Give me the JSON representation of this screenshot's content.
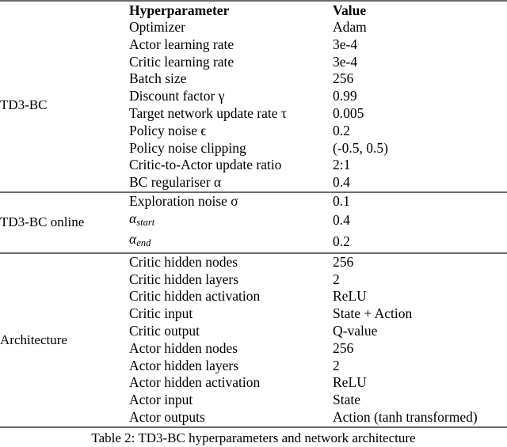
{
  "table": {
    "columns": {
      "group": "",
      "hyperparameter": "Hyperparameter",
      "value": "Value"
    },
    "groups": [
      {
        "label": "TD3-BC",
        "rows": [
          {
            "param": "Optimizer",
            "value": "Adam"
          },
          {
            "param": "Actor learning rate",
            "value": "3e-4"
          },
          {
            "param": "Critic learning rate",
            "value": "3e-4"
          },
          {
            "param": "Batch size",
            "value": "256"
          },
          {
            "param": "Discount factor γ",
            "value": "0.99"
          },
          {
            "param": "Target network update rate τ",
            "value": "0.005"
          },
          {
            "param": "Policy noise ϵ",
            "value": "0.2"
          },
          {
            "param": "Policy noise clipping",
            "value": "(-0.5, 0.5)"
          },
          {
            "param": "Critic-to-Actor update ratio",
            "value": "2:1"
          },
          {
            "param": "BC regulariser α",
            "value": "0.4"
          }
        ]
      },
      {
        "label": "TD3-BC online",
        "rows": [
          {
            "param": "Exploration noise σ",
            "value": "0.1"
          },
          {
            "param": "αstart",
            "param_base": "α",
            "param_sub": "start",
            "value": "0.4"
          },
          {
            "param": "αend",
            "param_base": "α",
            "param_sub": "end",
            "value": "0.2"
          }
        ]
      },
      {
        "label": "Architecture",
        "rows": [
          {
            "param": "Critic hidden nodes",
            "value": "256"
          },
          {
            "param": "Critic hidden layers",
            "value": "2"
          },
          {
            "param": "Critic hidden activation",
            "value": "ReLU"
          },
          {
            "param": "Critic input",
            "value": "State + Action"
          },
          {
            "param": "Critic output",
            "value": "Q-value"
          },
          {
            "param": "Actor hidden nodes",
            "value": "256"
          },
          {
            "param": "Actor hidden layers",
            "value": "2"
          },
          {
            "param": "Actor hidden activation",
            "value": "ReLU"
          },
          {
            "param": "Actor input",
            "value": "State"
          },
          {
            "param": "Actor outputs",
            "value": "Action (tanh transformed)"
          }
        ]
      }
    ]
  },
  "caption": "Table 2: TD3-BC hyperparameters and network architecture",
  "colors": {
    "rule": "#6b6b6b",
    "text": "#000000",
    "background": "#ffffff"
  }
}
